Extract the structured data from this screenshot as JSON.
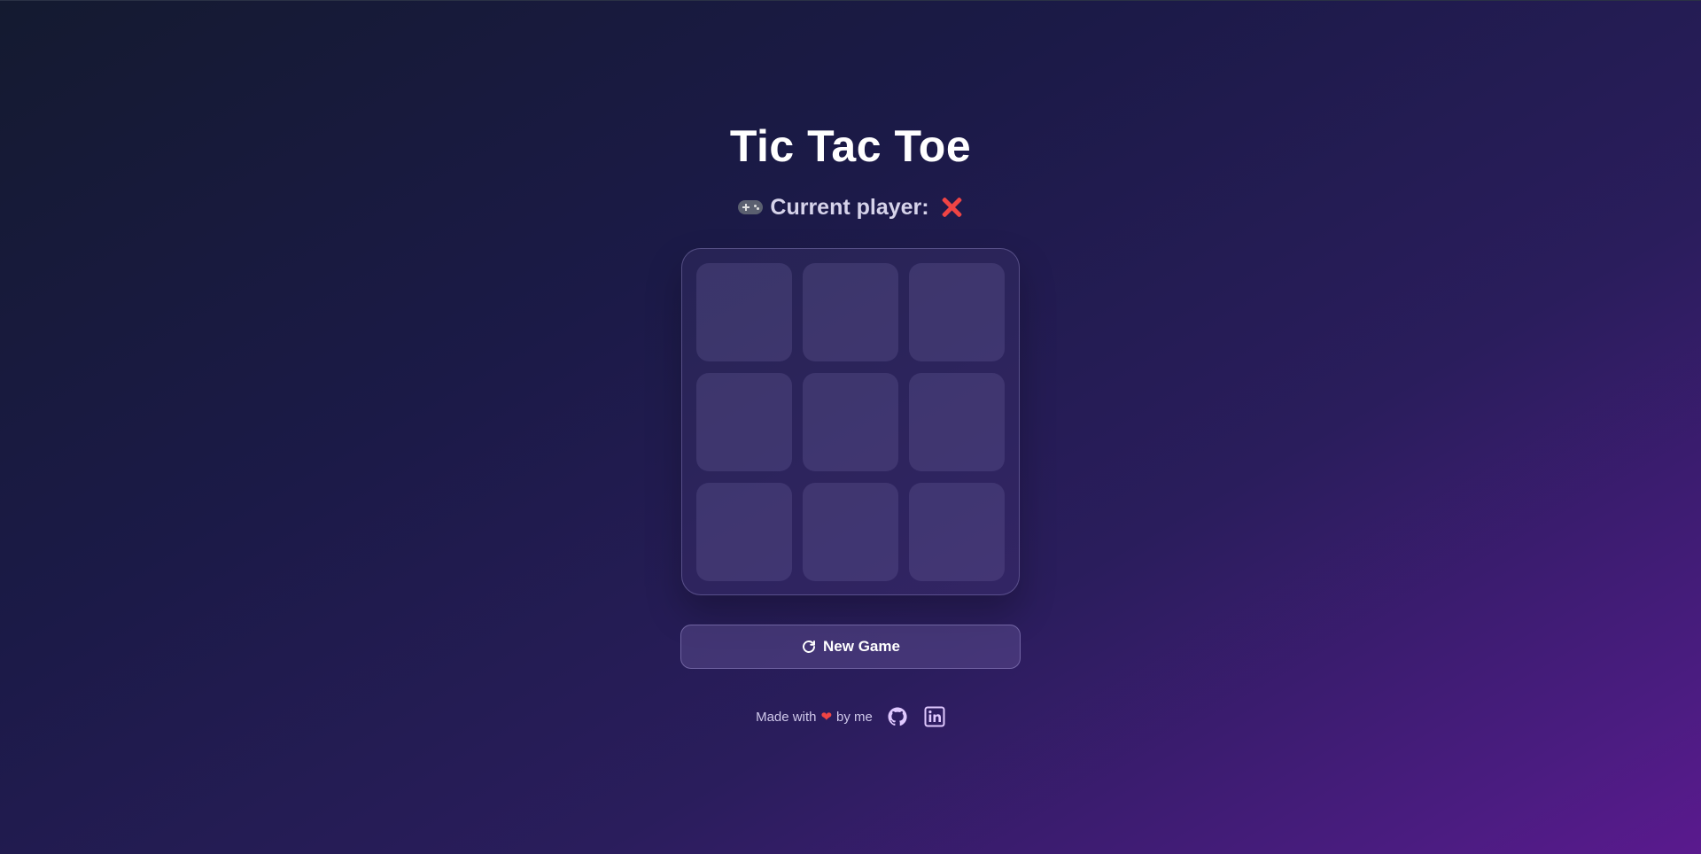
{
  "title": "Tic Tac Toe",
  "status": {
    "icon": "gamepad-icon",
    "label": "Current player:",
    "current_player_icon": "red-x-mark-icon",
    "current_player": "X"
  },
  "board": {
    "cells": [
      "",
      "",
      "",
      "",
      "",
      "",
      "",
      "",
      ""
    ]
  },
  "new_game_button": {
    "icon": "refresh-icon",
    "label": "New Game"
  },
  "footer": {
    "text_before": "Made with",
    "heart": "❤",
    "text_after": "by me",
    "links": [
      {
        "icon": "github-icon"
      },
      {
        "icon": "linkedin-icon"
      }
    ]
  },
  "colors": {
    "accent_x": "#ef4444",
    "footer_icon": "#e0c9ff",
    "background_start": "#141a30",
    "background_end": "#5a1a8e"
  }
}
